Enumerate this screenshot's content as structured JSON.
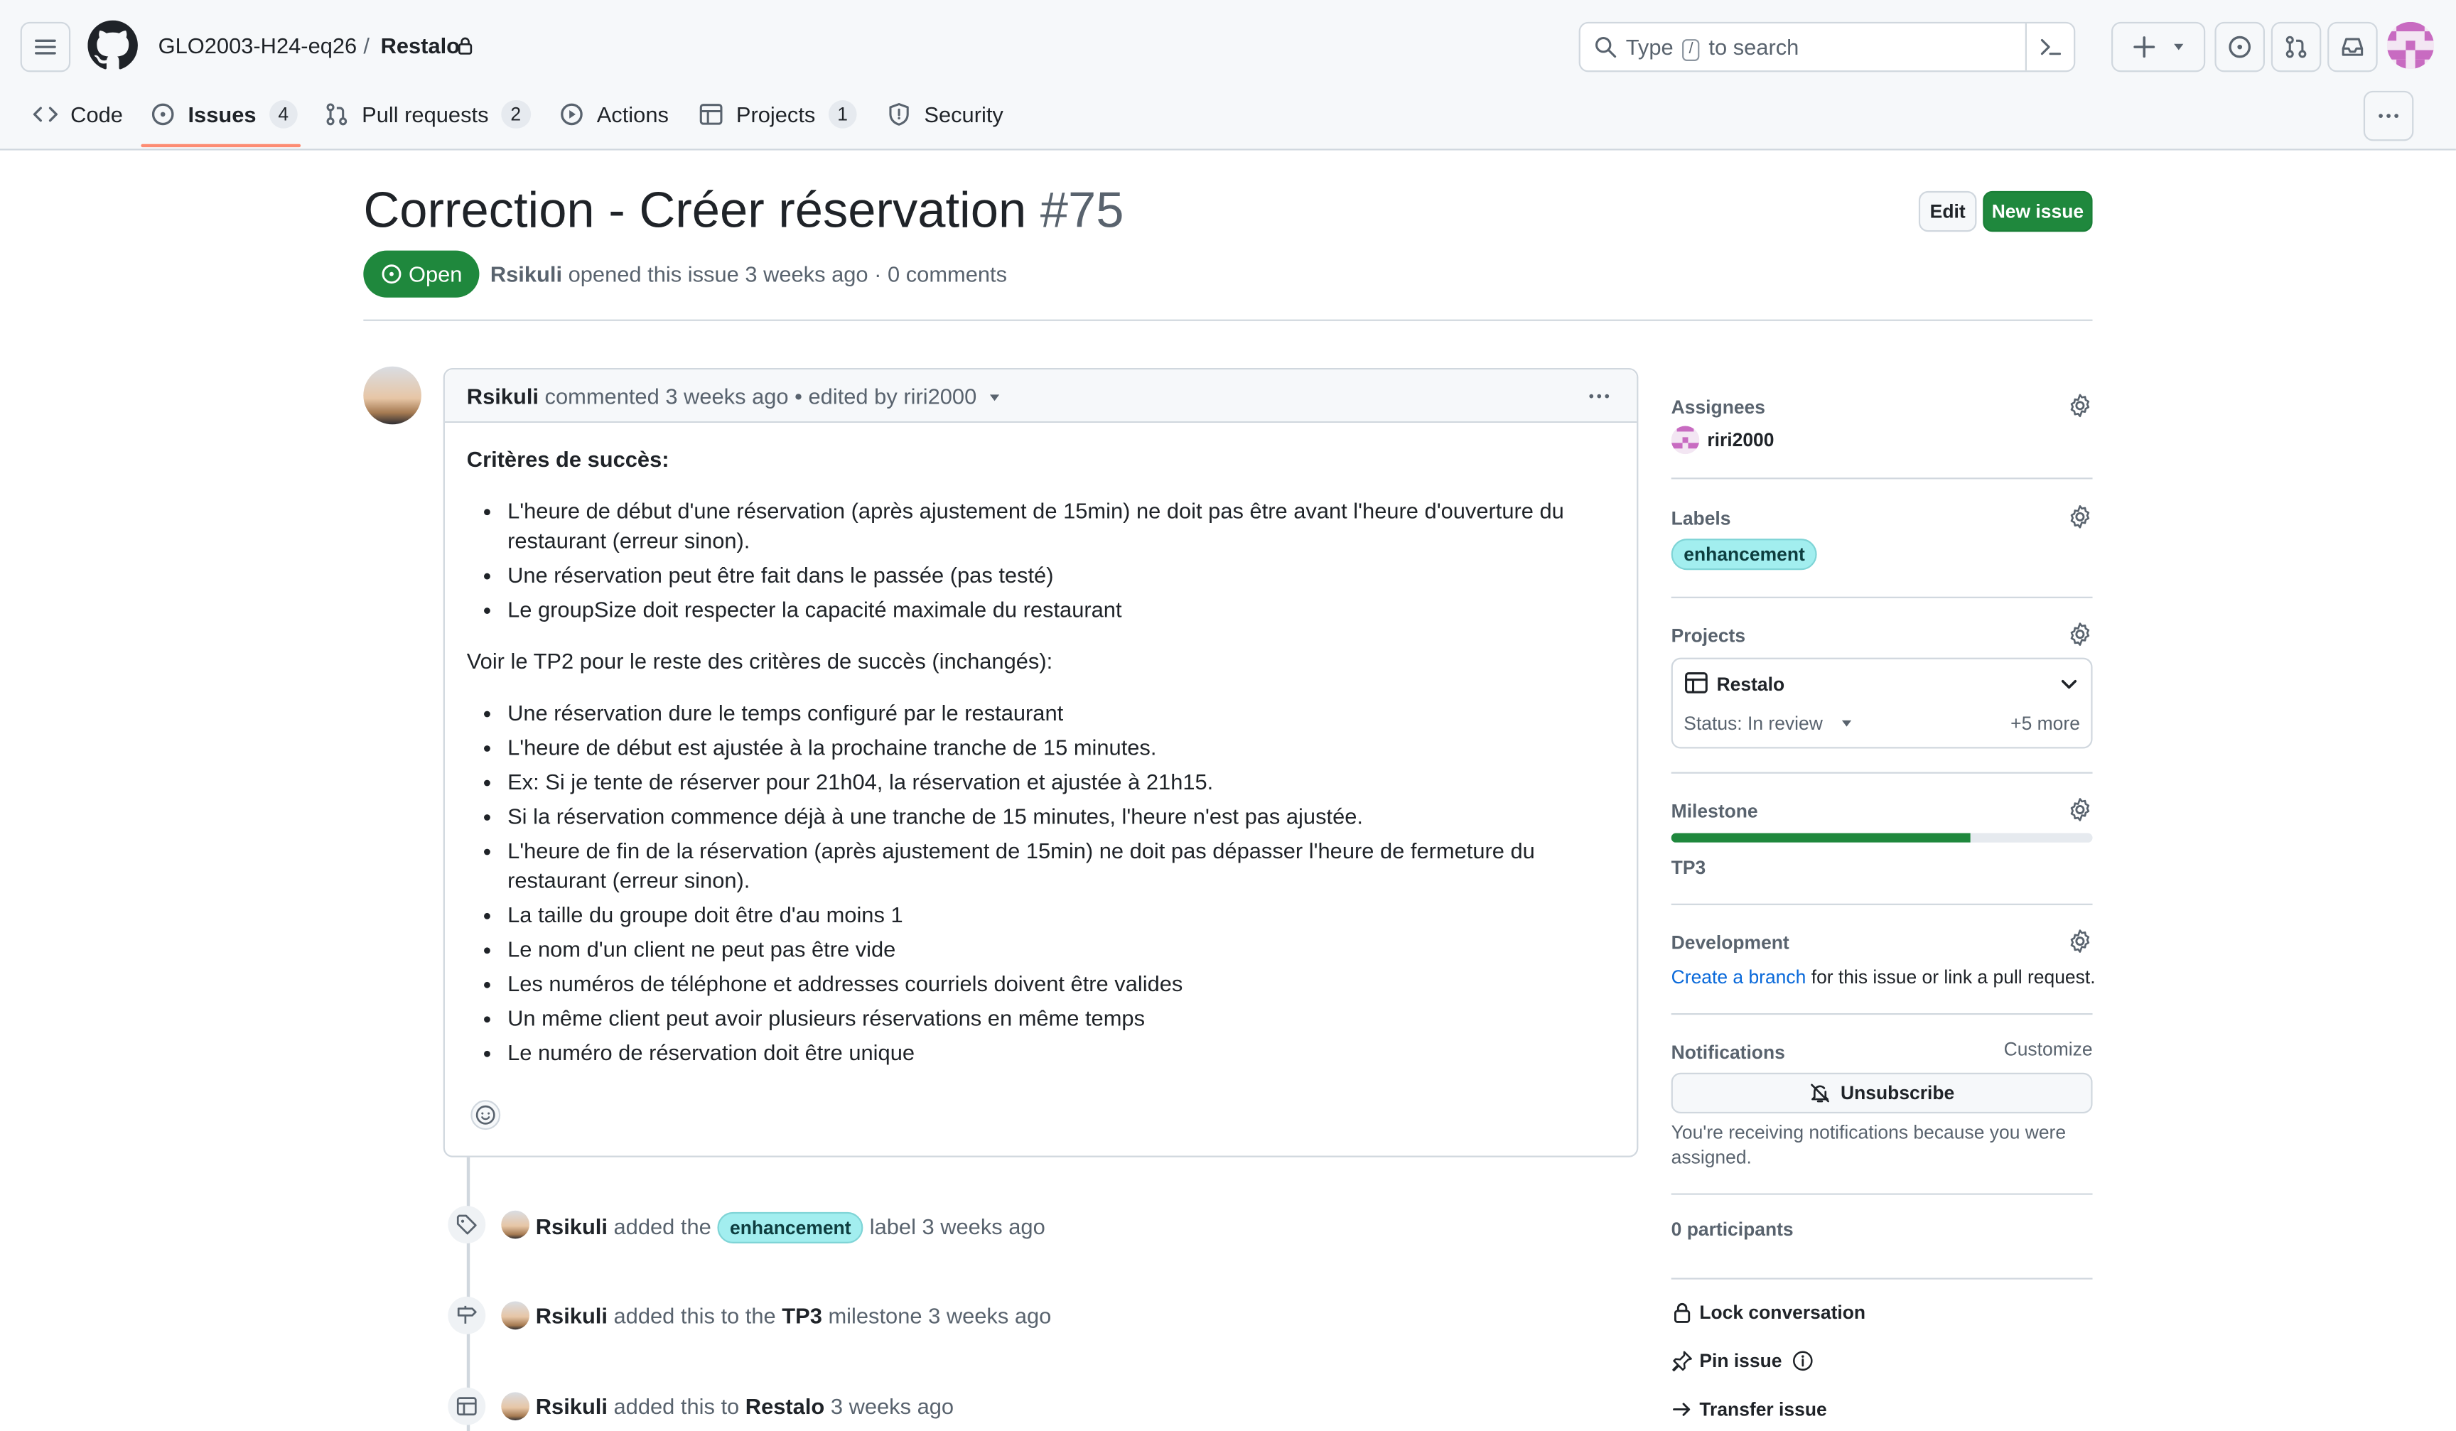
{
  "header": {
    "owner": "GLO2003-H24-eq26",
    "separator": "/",
    "repo": "Restalo",
    "search_before": "Type",
    "search_key": "/",
    "search_after": "to search"
  },
  "tabs": [
    {
      "label": "Code",
      "icon": "code-icon"
    },
    {
      "label": "Issues",
      "count": "4",
      "icon": "issue-icon",
      "active": true
    },
    {
      "label": "Pull requests",
      "count": "2",
      "icon": "pull-request-icon"
    },
    {
      "label": "Actions",
      "icon": "play-icon"
    },
    {
      "label": "Projects",
      "count": "1",
      "icon": "table-icon"
    },
    {
      "label": "Security",
      "icon": "shield-icon"
    }
  ],
  "issue": {
    "title": "Correction - Créer réservation",
    "number": "#75",
    "state": "Open",
    "author": "Rsikuli",
    "meta_rest": "opened this issue 3 weeks ago · 0 comments",
    "edit_label": "Edit",
    "new_label": "New issue"
  },
  "comment": {
    "author": "Rsikuli",
    "action": "commented 3 weeks ago • edited by riri2000",
    "heading": "Critères de succès:",
    "list1": [
      "L'heure de début d'une réservation (après ajustement de 15min) ne doit pas être avant l'heure d'ouverture du restaurant (erreur sinon).",
      "Une réservation peut être fait dans le passée (pas testé)",
      "Le groupSize doit respecter la capacité maximale du restaurant"
    ],
    "paragraph": "Voir le TP2 pour le reste des critères de succès (inchangés):",
    "list2": [
      "Une réservation dure le temps configuré par le restaurant",
      "L'heure de début est ajustée à la prochaine tranche de 15 minutes.",
      "Ex: Si je tente de réserver pour 21h04, la réservation et ajustée à 21h15.",
      "Si la réservation commence déjà à une tranche de 15 minutes, l'heure n'est pas ajustée.",
      "L'heure de fin de la réservation (après ajustement de 15min) ne doit pas dépasser l'heure de fermeture du restaurant (erreur sinon).",
      "La taille du groupe doit être d'au moins 1",
      "Le nom d'un client ne peut pas être vide",
      "Les numéros de téléphone et addresses courriels doivent être valides",
      "Un même client peut avoir plusieurs réservations en même temps",
      "Le numéro de réservation doit être unique"
    ]
  },
  "timeline": [
    {
      "actor": "Rsikuli",
      "pre": "added the",
      "label": "enhancement",
      "post": "label 3 weeks ago",
      "icon": "tag-icon"
    },
    {
      "actor": "Rsikuli",
      "pre": "added this to the",
      "target": "TP3",
      "post": "milestone 3 weeks ago",
      "icon": "milestone-icon"
    },
    {
      "actor": "Rsikuli",
      "pre": "added this to",
      "target": "Restalo",
      "post": "3 weeks ago",
      "icon": "table-icon"
    }
  ],
  "sidebar": {
    "assignees_h": "Assignees",
    "assignee": "riri2000",
    "labels_h": "Labels",
    "label": "enhancement",
    "projects_h": "Projects",
    "project_name": "Restalo",
    "project_status": "Status: In review",
    "project_more": "+5 more",
    "milestone_h": "Milestone",
    "milestone": "TP3",
    "milestone_progress": 0.71,
    "development_h": "Development",
    "dev_link": "Create a branch",
    "dev_rest": "for this issue or link a pull request.",
    "notifications_h": "Notifications",
    "customize": "Customize",
    "unsubscribe": "Unsubscribe",
    "notif_reason": "You're receiving notifications because you were assigned.",
    "participants": "0 participants",
    "lock": "Lock conversation",
    "pin": "Pin issue",
    "transfer": "Transfer issue"
  },
  "colors": {
    "accent_green": "#1f883d",
    "tab_underline": "#fd8c73",
    "label_bg": "#a2eeef",
    "link": "#0969da"
  }
}
